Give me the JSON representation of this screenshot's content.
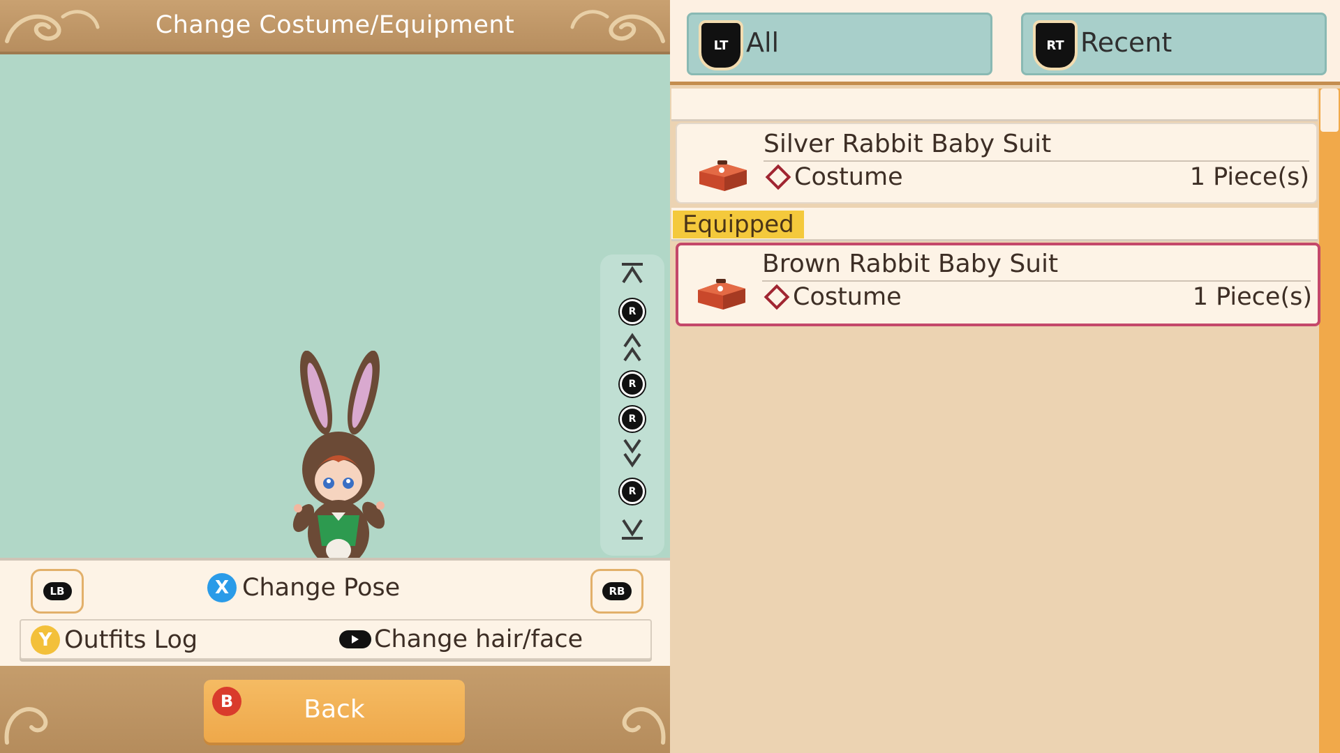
{
  "header": {
    "title": "Change Costume/Equipment"
  },
  "controls": {
    "lb": "LB",
    "rb": "RB",
    "x_button": "X",
    "change_pose": "Change Pose",
    "y_button": "Y",
    "outfits_log": "Outfits Log",
    "change_hair_face": "Change hair/face"
  },
  "view_controls": {
    "r": "R"
  },
  "back": {
    "b_button": "B",
    "label": "Back"
  },
  "filters": [
    {
      "badge": "LT",
      "label": "All"
    },
    {
      "badge": "RT",
      "label": "Recent"
    }
  ],
  "items": [
    {
      "name": "Silver Rabbit Baby Suit",
      "category": "Costume",
      "qty": "1 Piece(s)"
    },
    {
      "name": "Brown Rabbit Baby Suit",
      "category": "Costume",
      "qty": "1 Piece(s)"
    }
  ],
  "equipped_label": "Equipped",
  "colors": {
    "accent": "#f1a94a",
    "selected": "#c4486a",
    "preview_bg": "#b1d7c7",
    "x_blue": "#2a9be8",
    "y_yellow": "#f3c03a",
    "b_red": "#d93b2c"
  }
}
